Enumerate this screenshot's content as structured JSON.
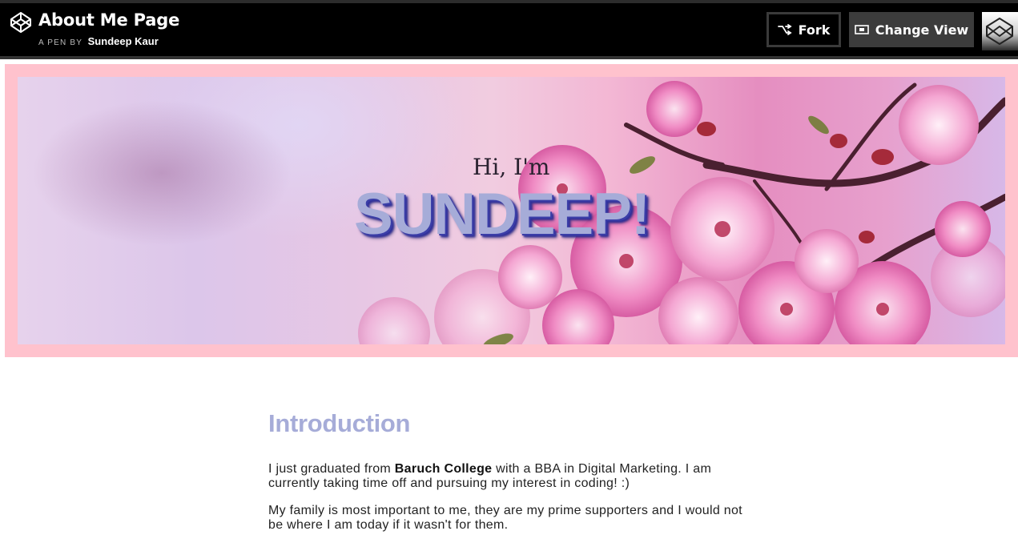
{
  "header": {
    "title": "About Me Page",
    "byline_prefix": "A PEN BY",
    "author": "Sundeep Kaur",
    "fork_label": "Fork",
    "change_view_label": "Change View",
    "icons": [
      "codepen-logo-icon",
      "fork-icon",
      "change-view-icon",
      "avatar"
    ]
  },
  "hero": {
    "greeting": "Hi, I'm",
    "name": "SUNDEEP!"
  },
  "intro": {
    "heading": "Introduction",
    "p1_before": "I just graduated from ",
    "p1_bold": "Baruch College",
    "p1_after": " with a BBA in Digital Marketing. I am currently taking time off and pursuing my interest in coding! :)",
    "p2": "My family is most important to me, they are my prime supporters and I would not be where I am today if it wasn't for them."
  },
  "colors": {
    "accent": "#a6acd8",
    "frame": "#ffc2cd",
    "topbar": "#000000"
  }
}
